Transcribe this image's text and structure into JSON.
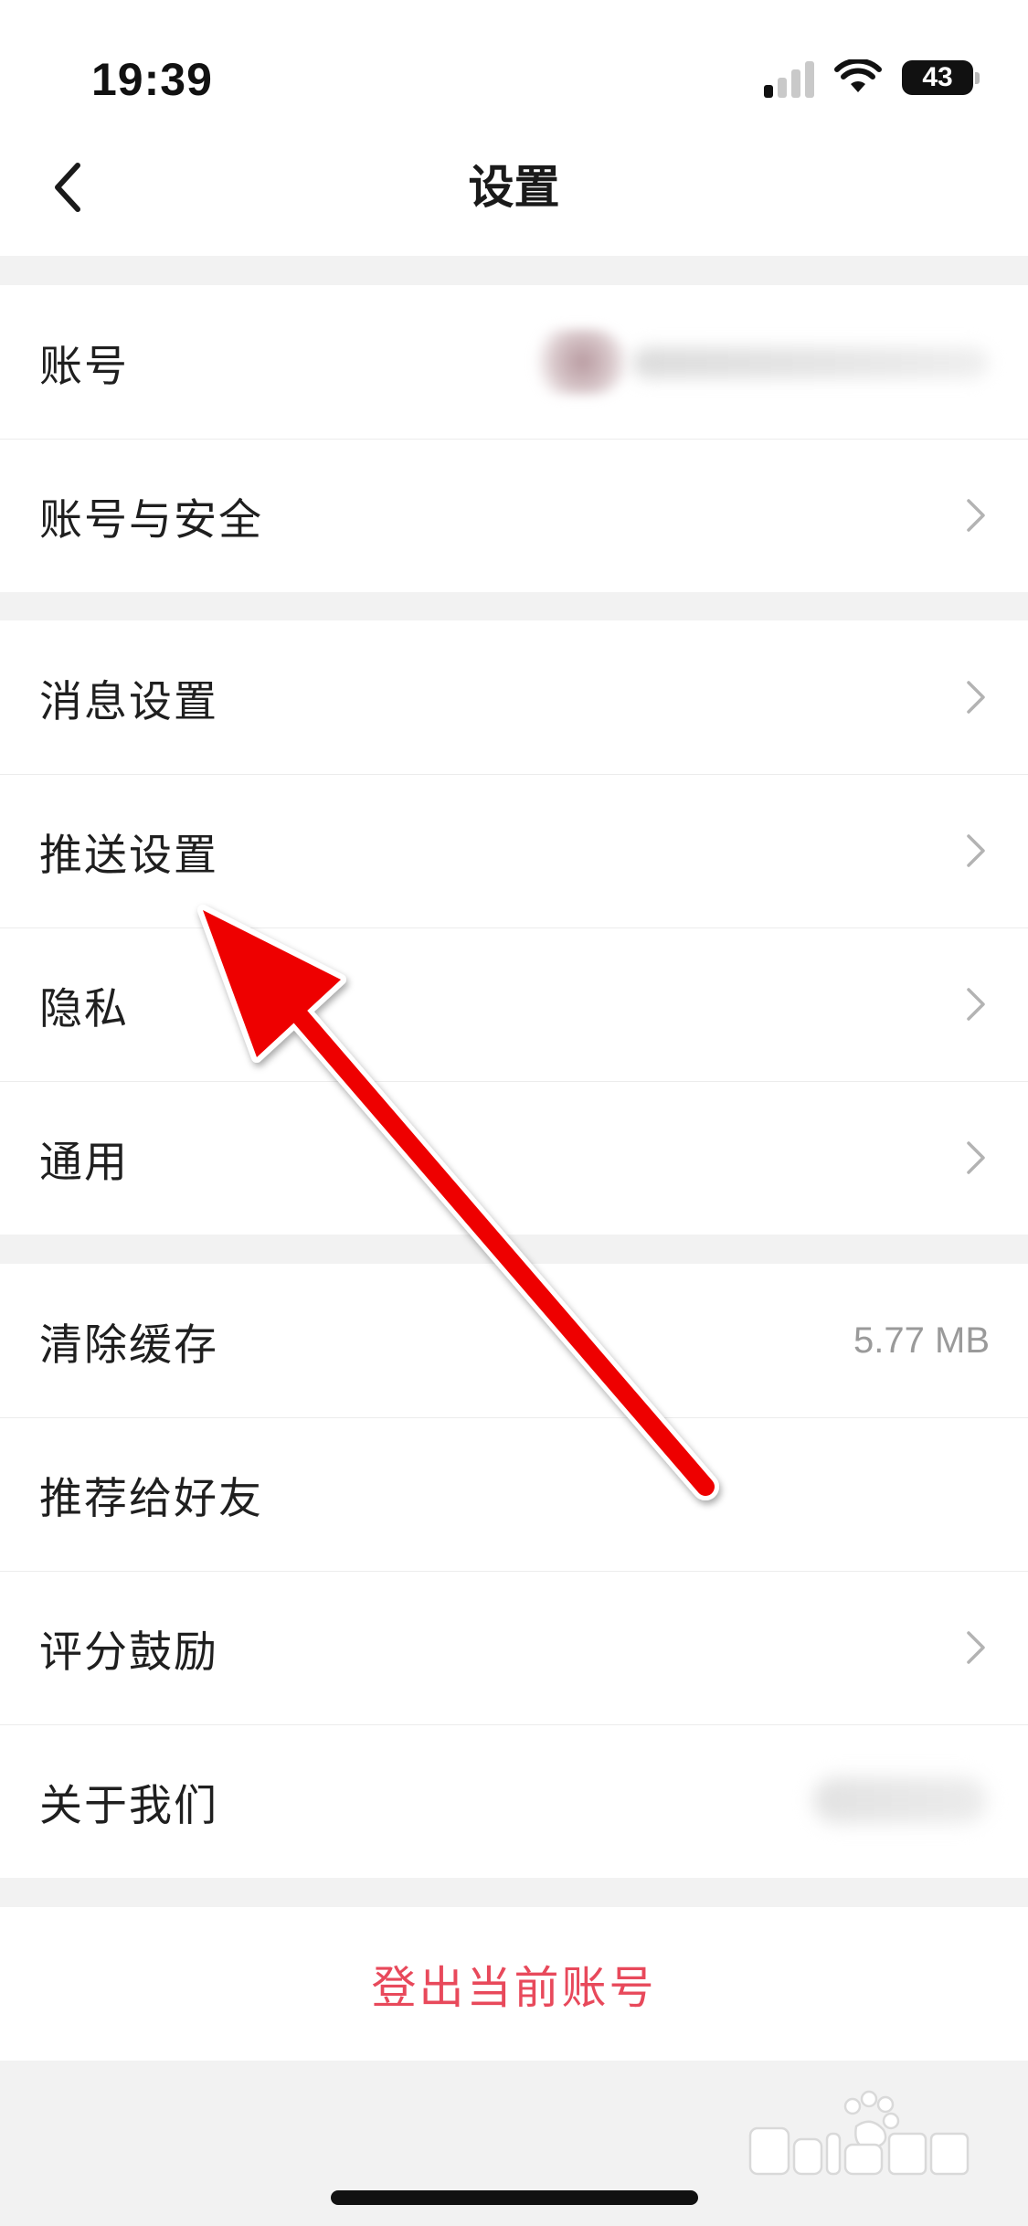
{
  "status_bar": {
    "time": "19:39",
    "battery": "43"
  },
  "nav": {
    "title": "设置"
  },
  "groups": [
    {
      "items": [
        {
          "label": "账号"
        },
        {
          "label": "账号与安全"
        }
      ]
    },
    {
      "items": [
        {
          "label": "消息设置"
        },
        {
          "label": "推送设置"
        },
        {
          "label": "隐私"
        },
        {
          "label": "通用"
        }
      ]
    },
    {
      "items": [
        {
          "label": "清除缓存",
          "value": "5.77 MB"
        },
        {
          "label": "推荐给好友"
        },
        {
          "label": "评分鼓励"
        },
        {
          "label": "关于我们"
        }
      ]
    }
  ],
  "logout": {
    "label": "登出当前账号"
  },
  "colors": {
    "logout_text": "#e8495b",
    "annotation_arrow": "#ee0000",
    "background": "#f2f2f2"
  }
}
